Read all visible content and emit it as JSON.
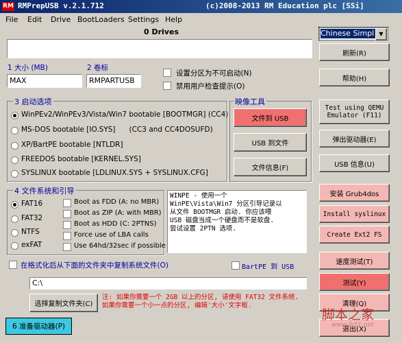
{
  "app": {
    "title": "RMPrepUSB v.2.1.712",
    "copyright": "(c)2008-2013 RM Education plc [SSi]",
    "logo": "RM"
  },
  "menu": [
    "File",
    "Edit",
    "Drive",
    "BootLoaders",
    "Settings",
    "Help"
  ],
  "drives_header": "0 Drives",
  "language": {
    "value": "Chinese Simpl"
  },
  "buttons_right_top": {
    "refresh": "刷新(R)",
    "help": "帮助(H)"
  },
  "size": {
    "label": "1 大小 (MB)",
    "value": "MAX"
  },
  "volume": {
    "label": "2 卷标",
    "value": "RMPARTUSB"
  },
  "options": {
    "non_bootable": "设置分区为不可启动(N)",
    "no_prompts": "禁用用户检查提示(O)"
  },
  "boot": {
    "label": "3 启动选项",
    "items": [
      {
        "text": "WinPEv2/WinPEv3/Vista/Win7 bootable [BOOTMGR] (CC4)",
        "selected": true
      },
      {
        "text": "MS-DOS bootable [IO.SYS]      (CC3 and CC4DOSUFD)",
        "selected": false
      },
      {
        "text": "XP/BartPE bootable [NTLDR]",
        "selected": false
      },
      {
        "text": "FREEDOS bootable [KERNEL.SYS]",
        "selected": false
      },
      {
        "text": "SYSLINUX bootable [LDLINUX.SYS + SYSLINUX.CFG]",
        "selected": false
      }
    ]
  },
  "image_tools": {
    "label": "映像工具",
    "file_to_usb": "文件到 USB",
    "usb_to_file": "USB 到文件",
    "file_info": "文件信息(F)"
  },
  "right_buttons": {
    "test_qemu": "Test using QEMU Emulator (F11)",
    "eject": "弹出驱动器(E)",
    "usb_info": "USB 信息(U)",
    "install_grub4dos": "安装 Grub4dos",
    "install_syslinux": "Install syslinux",
    "create_ext2": "Create Ext2 FS",
    "speed_test": "速度测试(T)",
    "test": "测试(Y)",
    "clean": "清理(Q)",
    "exit": "退出(X)"
  },
  "fs": {
    "label": "4 文件系统和引导",
    "items": [
      {
        "text": "FAT16",
        "selected": true
      },
      {
        "text": "FAT32",
        "selected": false
      },
      {
        "text": "NTFS",
        "selected": false
      },
      {
        "text": "exFAT",
        "selected": false
      }
    ],
    "checks": [
      "Boot as FDD (A: no MBR)",
      "Boot as ZIP (A: with MBR)",
      "Boot as HDD (C: 2PTNS)",
      "Force use of LBA calls",
      "Use 64hd/32sec if possible"
    ]
  },
  "info_text": "WINPE - 使用一个\nWinPE\\Vista\\Win7 分区引导记录以\n从文件 BOOTMGR 启动. 你应该喂\nUSB 磁盘当成一个硬盘而不是软盘.\n尝试设置 2PTN 选项.",
  "copy_files": {
    "label": "在格式化后从下面的文件夹中复制系统文件(O)",
    "path": "C:\\",
    "choose": "选择复制文件夹(C)"
  },
  "bartpe": "BartPE 到 USB",
  "note": "注: 如果你需要一个 2GB 以上的分区, 请使用 FAT32 文件系统. 如果你需要一个小一点的分区, 编辑'大小'文字框.",
  "prepare": "6 准备驱动器(P)",
  "watermark": {
    "main": "脚本之家",
    "sub": "www.jb51.net"
  }
}
